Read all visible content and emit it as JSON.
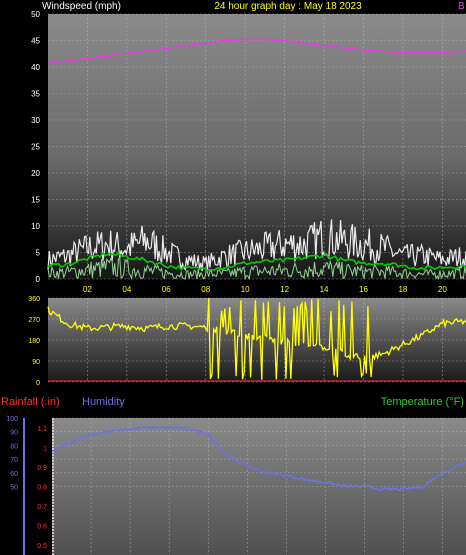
{
  "header": {
    "left": "Windspeed (mph)",
    "center": "24 hour graph day : May 18 2023",
    "right_fragment": "B"
  },
  "bottom_header": {
    "rainfall": "Rainfall (.in)",
    "humidity": "Humidity",
    "temperature": "Temperature (°F)"
  },
  "colors": {
    "windspeed": "#ffffff",
    "average": "#00cc00",
    "pink_series": "#e040e0",
    "direction": "#ffff00",
    "humidity": "#7070e0",
    "rainfall": "#ff3030",
    "temperature": "#33cc33",
    "header_center": "#ffff00",
    "tick_labels": "#ffff00",
    "left_tick_labels": "#ffffff"
  },
  "chart_data": [
    {
      "type": "line",
      "title": "24 hour graph day : May 18 2023",
      "ylabel": "Windspeed (mph)",
      "ylim": [
        0,
        50
      ],
      "y_ticks": [
        0,
        5,
        10,
        15,
        20,
        25,
        30,
        35,
        40,
        45,
        50
      ],
      "x_ticks": [
        "02",
        "04",
        "06",
        "08",
        "10",
        "12",
        "14",
        "16",
        "18",
        "20"
      ],
      "x_tick_hours": [
        2,
        4,
        6,
        8,
        10,
        12,
        14,
        16,
        18,
        20
      ],
      "xlim_hours": [
        0,
        21.2
      ],
      "grid": true,
      "series": [
        {
          "role": "pink",
          "x": [
            0,
            2,
            4,
            6,
            8,
            9,
            10,
            11,
            12,
            13,
            14,
            16,
            18,
            20,
            21.2
          ],
          "values": [
            40.7,
            41.6,
            42.6,
            43.5,
            44.5,
            45.0,
            45.2,
            45.2,
            45.0,
            44.5,
            44.0,
            43.2,
            42.7,
            42.7,
            43.0
          ]
        },
        {
          "role": "gust",
          "x": [
            0,
            1,
            2,
            3,
            4,
            5,
            6,
            7,
            8,
            9,
            10,
            11,
            12,
            13,
            14,
            15,
            16,
            17,
            18,
            19,
            20,
            21.2
          ],
          "values": [
            5,
            6,
            8,
            9,
            8,
            10,
            7,
            5,
            4,
            6,
            7,
            8,
            9,
            9,
            11,
            10,
            9,
            8,
            6,
            6,
            5,
            6
          ]
        },
        {
          "role": "average",
          "x": [
            0,
            1,
            2,
            3,
            4,
            5,
            6,
            7,
            8,
            9,
            10,
            11,
            12,
            13,
            14,
            15,
            16,
            17,
            18,
            19,
            20,
            21.2
          ],
          "values": [
            2.5,
            2.8,
            3.8,
            4.8,
            4.2,
            3.5,
            2.5,
            2,
            2,
            2.2,
            3,
            3.3,
            3.5,
            4,
            4.5,
            3.5,
            3,
            3,
            2.5,
            2,
            2.2,
            2.5
          ]
        }
      ]
    },
    {
      "type": "line",
      "ylabel": "Wind direction",
      "ylim": [
        0,
        360
      ],
      "y_ticks": [
        0,
        90,
        180,
        270,
        360
      ],
      "xlim_hours": [
        0,
        21.2
      ],
      "series": [
        {
          "role": "direction",
          "x": [
            0,
            1,
            2,
            3,
            4,
            5,
            6,
            7,
            8,
            9,
            10,
            11,
            12,
            13,
            14,
            15,
            16,
            17,
            18,
            19,
            20,
            21.2
          ],
          "values": [
            310,
            250,
            230,
            235,
            240,
            230,
            240,
            240,
            235,
            220,
            200,
            190,
            170,
            160,
            150,
            120,
            100,
            120,
            160,
            200,
            250,
            260
          ]
        }
      ]
    },
    {
      "type": "line",
      "ylabel": "Humidity",
      "ylim": [
        0,
        100
      ],
      "y_ticks": [
        50,
        60,
        70,
        80,
        90,
        100
      ],
      "rain_ylim": [
        0,
        1.2
      ],
      "rain_ticks": [
        "0.5",
        "0.6",
        "0.7",
        "0.8",
        "0.9",
        "1",
        "1.1"
      ],
      "xlim_hours": [
        0,
        21.2
      ],
      "series": [
        {
          "role": "humidity",
          "x": [
            0,
            1,
            2,
            3,
            4,
            5,
            6,
            7,
            8,
            9,
            10,
            11,
            12,
            13,
            14,
            15,
            16,
            17,
            18,
            19,
            20,
            21.2
          ],
          "values": [
            75,
            83,
            88,
            90,
            92,
            93,
            93,
            92,
            88,
            72,
            65,
            60,
            58,
            55,
            53,
            50,
            50,
            48,
            48,
            50,
            60,
            68
          ]
        }
      ]
    }
  ]
}
